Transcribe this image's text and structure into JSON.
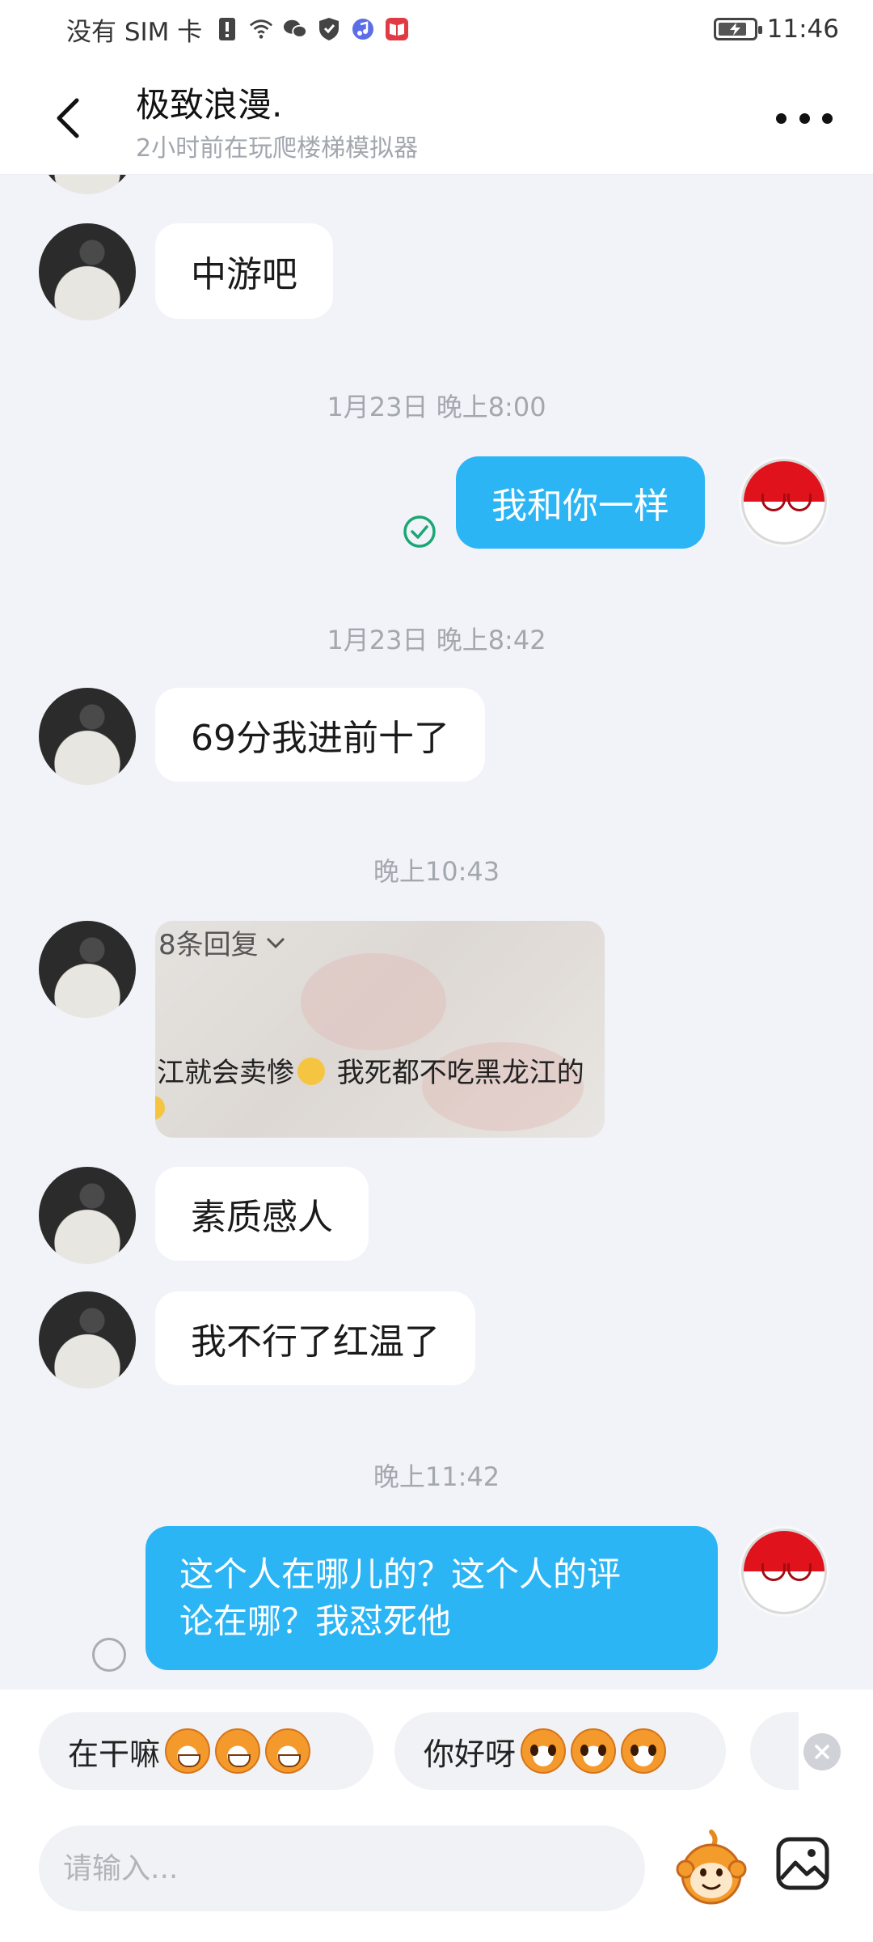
{
  "status_bar": {
    "carrier": "没有 SIM 卡",
    "time": "11:46",
    "icons": [
      "sim-alert-icon",
      "wifi-icon",
      "wechat-icon",
      "shield-icon",
      "music-icon",
      "book-app-icon",
      "battery-charging-icon"
    ]
  },
  "header": {
    "name": "极致浪漫.",
    "status": "2小时前在玩爬楼梯模拟器"
  },
  "messages": {
    "m1": "中游吧",
    "ts1": "1月23日 晚上8:00",
    "m2": "我和你一样",
    "ts2": "1月23日 晚上8:42",
    "m3": "69分我进前十了",
    "ts3": "晚上10:43",
    "image": {
      "reply_label": "8条回复",
      "comment_text_a": "江就会卖惨",
      "comment_text_b": " 我死都不吃黑龙江的"
    },
    "m4": "素质感人",
    "m5": "我不行了红温了",
    "ts4": "晚上11:42",
    "m6_line1": "这个人在哪儿的？这个人的评",
    "m6_line2": "论在哪？我怼死他"
  },
  "quick_replies": [
    {
      "label": "在干嘛"
    },
    {
      "label": "你好呀"
    }
  ],
  "input": {
    "placeholder": "请输入..."
  },
  "colors": {
    "accent": "#2bb5f5",
    "background": "#f1f3f8",
    "read_check": "#1aa774"
  }
}
